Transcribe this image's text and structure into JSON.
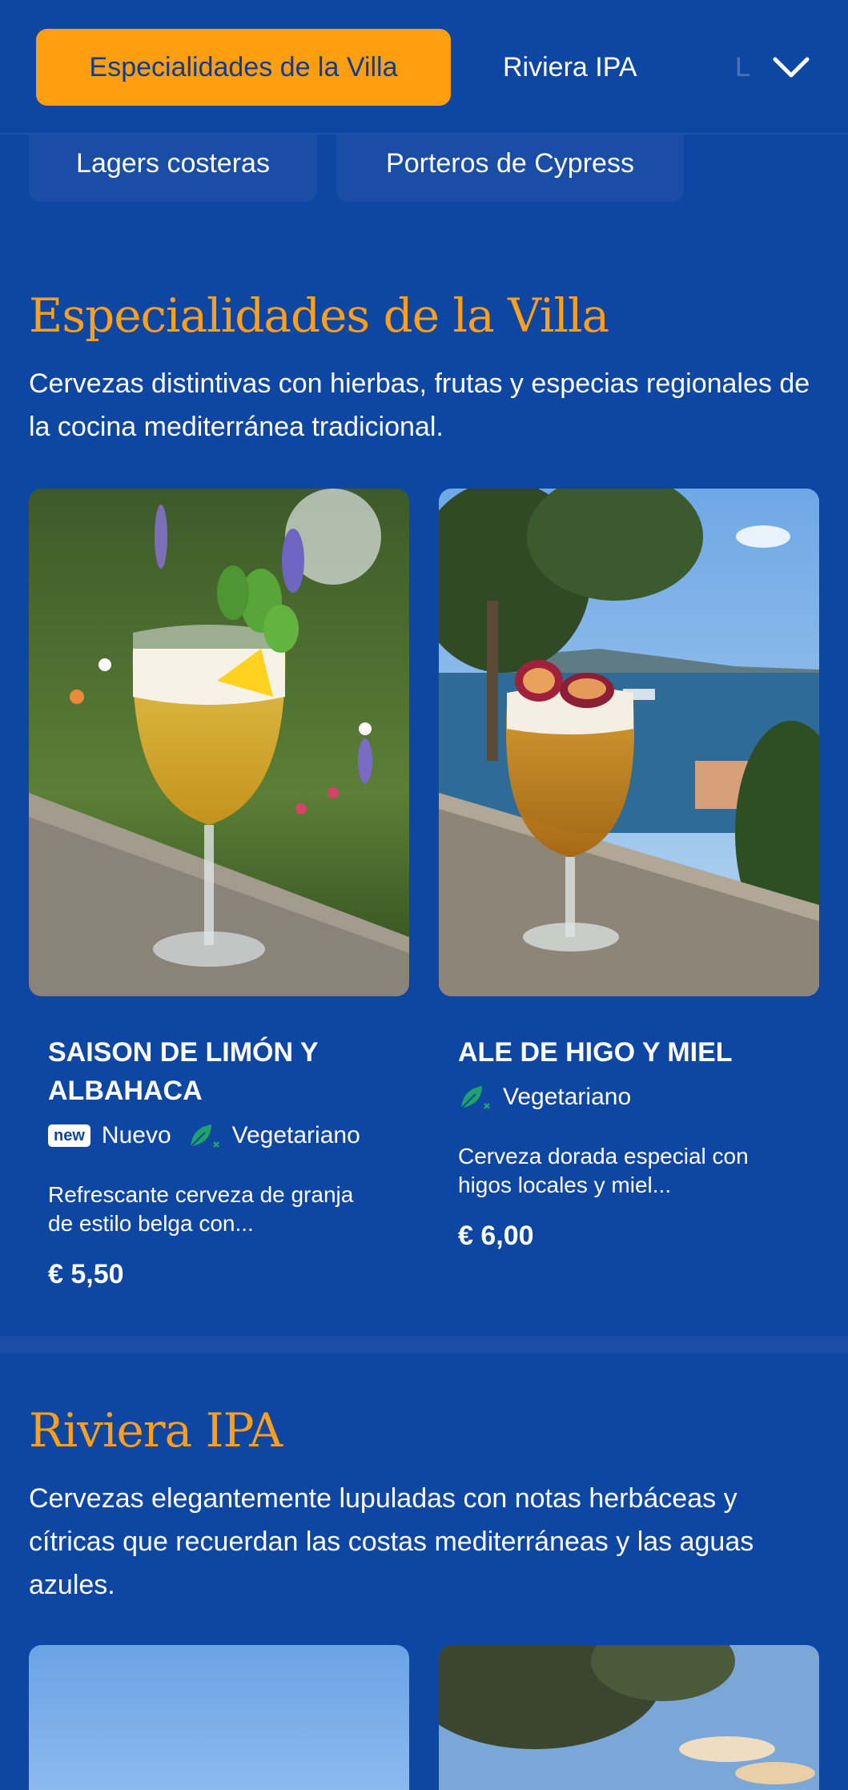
{
  "nav": {
    "tabs": [
      {
        "label": "Especialidades de la Villa",
        "active": true
      },
      {
        "label": "Riviera IPA",
        "active": false
      },
      {
        "label": "L",
        "active": false
      }
    ],
    "expand_icon": "chevron-down-icon",
    "subtabs": [
      "Lagers costeras",
      "Porteros de Cypress"
    ]
  },
  "sections": [
    {
      "title": "Especialidades de la Villa",
      "description": "Cervezas distintivas con hierbas, frutas y especias regionales de la cocina mediterránea tradicional.",
      "items": [
        {
          "name": "SAISON DE LIMÓN Y ALBAHACA",
          "badge": "new",
          "tags": [
            "Nuevo",
            "Vegetariano"
          ],
          "description": "Refrescante cerveza de granja de estilo belga con...",
          "price": "€ 5,50"
        },
        {
          "name": "ALE DE HIGO Y MIEL",
          "tags": [
            "Vegetariano"
          ],
          "description": "Cerveza dorada especial con higos locales y miel...",
          "price": "€ 6,00"
        }
      ]
    },
    {
      "title": "Riviera IPA",
      "description": "Cervezas elegantemente lupuladas con notas herbáceas y cítricas que recuerdan las costas mediterráneas y las aguas azules."
    }
  ],
  "colors": {
    "background": "#0e46a3",
    "accent": "#ff9f0f",
    "vegetarian_icon": "#1fa36b"
  }
}
